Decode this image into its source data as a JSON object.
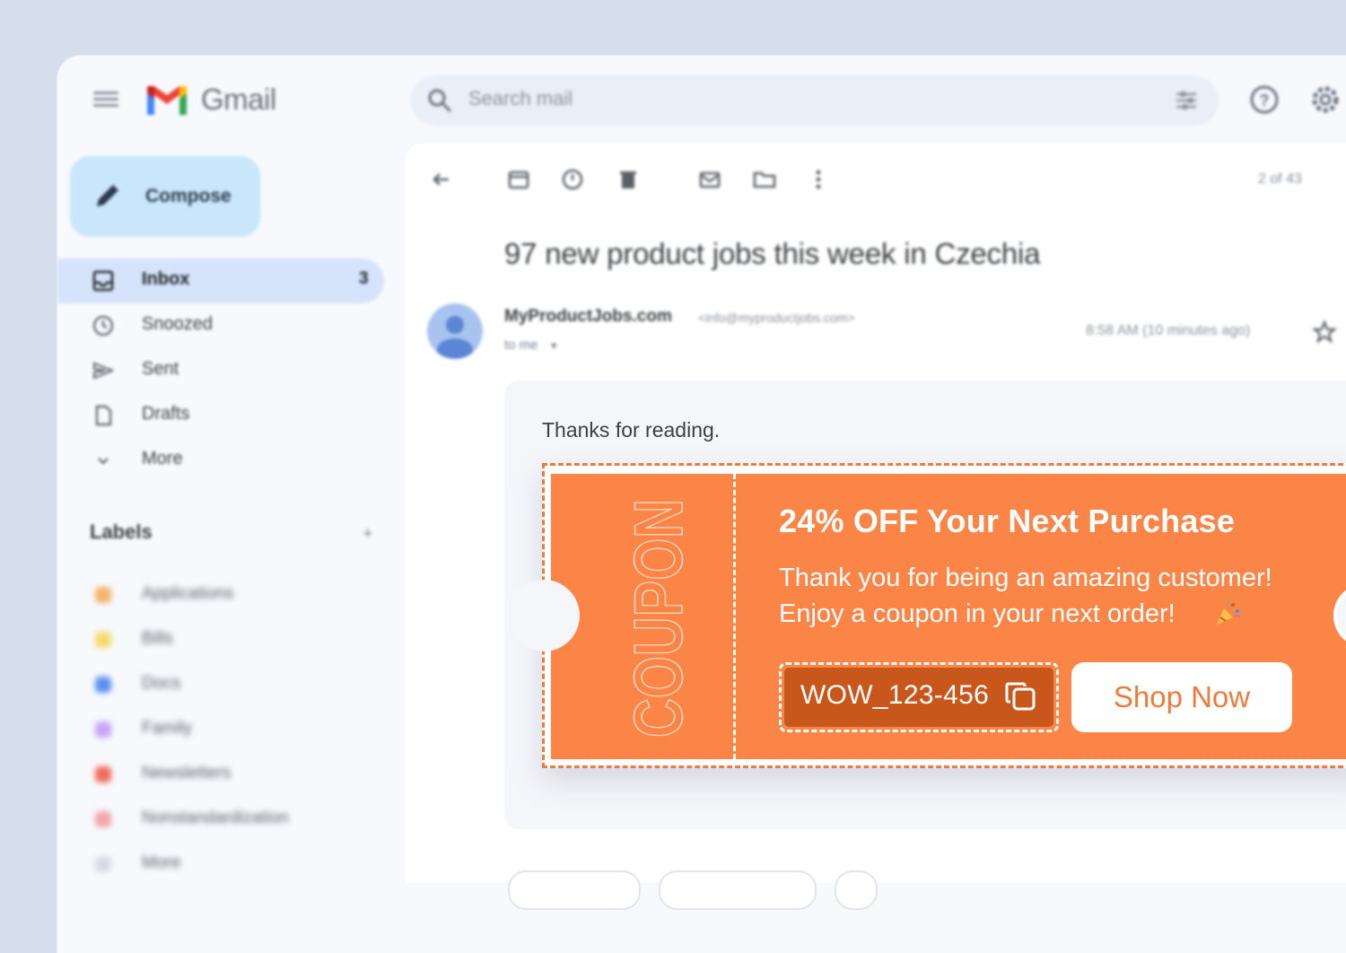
{
  "app": {
    "name": "Gmail"
  },
  "search": {
    "placeholder": "Search mail"
  },
  "sidebar": {
    "compose_label": "Compose",
    "items": [
      {
        "label": "Inbox",
        "count": "3",
        "icon": "inbox-icon",
        "active": true
      },
      {
        "label": "Snoozed",
        "icon": "clock-icon"
      },
      {
        "label": "Sent",
        "icon": "send-icon"
      },
      {
        "label": "Drafts",
        "icon": "draft-icon"
      },
      {
        "label": "More",
        "icon": "chevron-down-icon"
      }
    ],
    "labels_title": "Labels",
    "labels_add": "+",
    "labels": [
      {
        "label": "Applications",
        "color": "#f7b26a"
      },
      {
        "label": "Bills",
        "color": "#f6dc6b"
      },
      {
        "label": "Docs",
        "color": "#5b8ff0"
      },
      {
        "label": "Family",
        "color": "#c8a4f6"
      },
      {
        "label": "Newsletters",
        "color": "#f06a5a"
      },
      {
        "label": "Nonstandardization",
        "color": "#f2a6a6"
      },
      {
        "label": "More",
        "color": "#d7dbe2"
      }
    ]
  },
  "toolbar": {
    "pager": "2 of 43"
  },
  "email": {
    "subject": "97 new product jobs this week in Czechia",
    "sender_name": "MyProductJobs.com",
    "sender_email": "<info@myproductjobs.com>",
    "to": "to me",
    "timestamp": "8:58 AM (10 minutes ago)",
    "greeting": "Thanks for reading."
  },
  "coupon": {
    "side_label": "COUPON",
    "title": "24% OFF Your Next Purchase",
    "line1": "Thank you for being an amazing customer!",
    "line2": "Enjoy a coupon in your next order!",
    "code": "WOW_123-456",
    "cta": "Shop Now",
    "accent_color": "#fb8547",
    "code_bg_color": "#c9571c"
  }
}
